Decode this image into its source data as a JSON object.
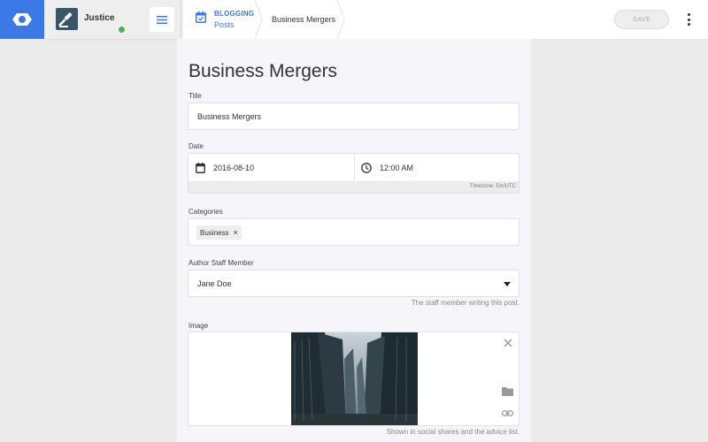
{
  "header": {
    "site_name": "Justice",
    "breadcrumb": {
      "section": "BLOGGING",
      "subsection": "Posts",
      "current": "Business Mergers"
    },
    "save_label": "SAVE"
  },
  "colors": {
    "accent": "#3b7ae6",
    "online": "#4caf50"
  },
  "icons": {
    "logo": "eye-logo-icon",
    "menu": "hamburger-menu-icon",
    "calendar": "calendar-icon",
    "clock": "clock-icon",
    "more": "more-vertical-icon",
    "dropdown": "caret-down-icon",
    "remove_image": "close-icon",
    "folder": "folder-icon",
    "link": "link-icon"
  },
  "form": {
    "page_title": "Business Mergers",
    "title": {
      "label": "Title",
      "value": "Business Mergers"
    },
    "date": {
      "label": "Date",
      "date_value": "2016-08-10",
      "time_value": "12:00 AM",
      "timezone_note": "Timezone: Etc/UTC"
    },
    "categories": {
      "label": "Categories",
      "chips": [
        "Business"
      ]
    },
    "author": {
      "label": "Author Staff Member",
      "value": "Jane Doe",
      "help": "The staff member writing this post."
    },
    "image": {
      "label": "Image",
      "help": "Shown in social shares and the advice list."
    }
  }
}
